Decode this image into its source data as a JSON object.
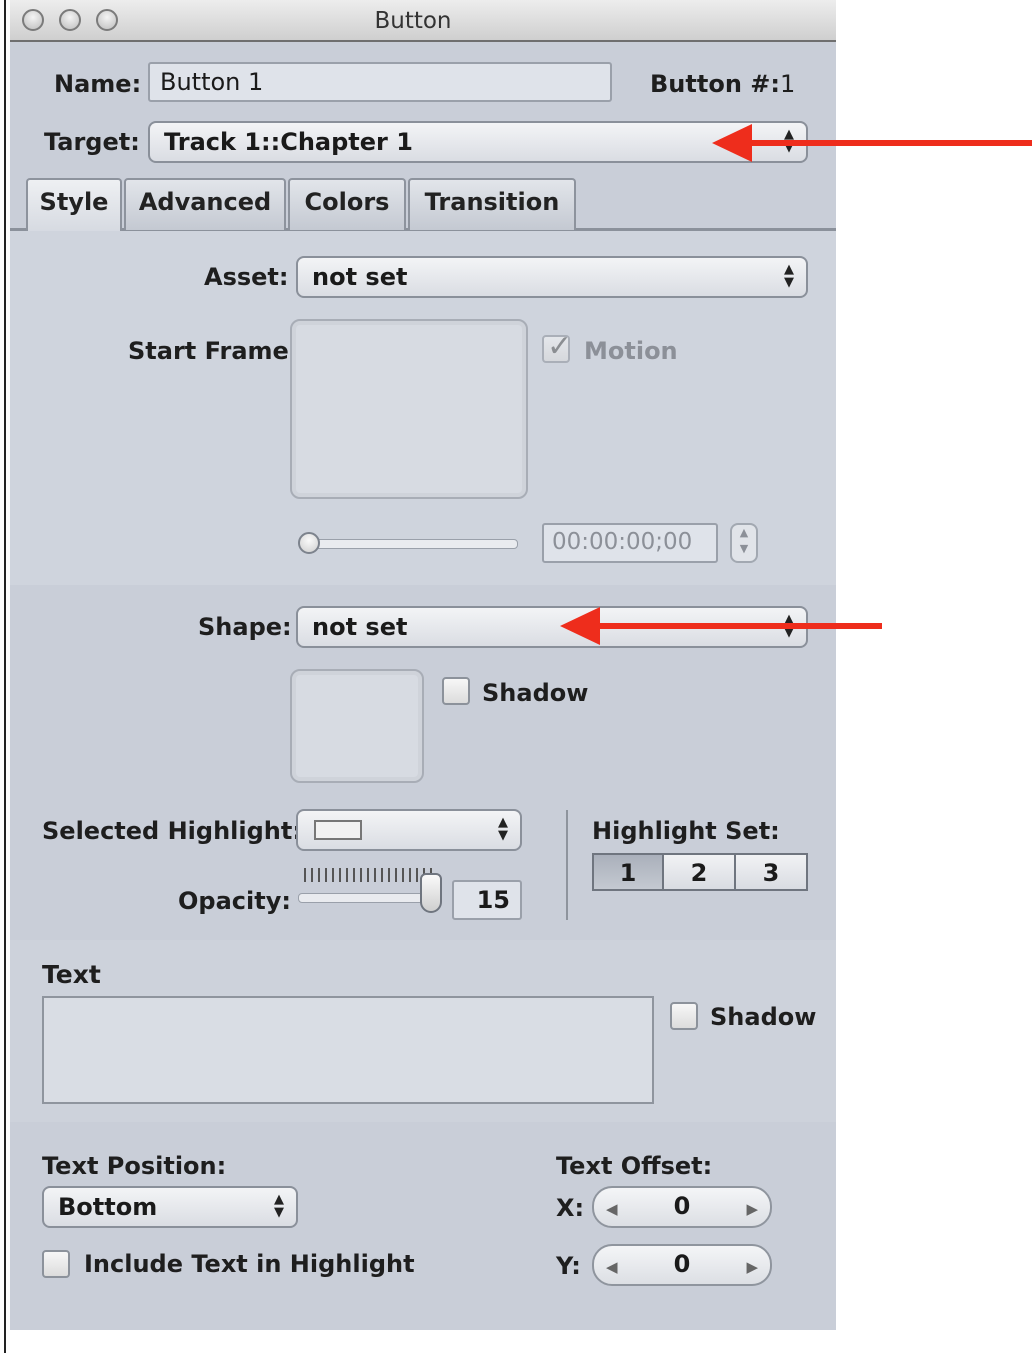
{
  "window": {
    "title": "Button"
  },
  "name_row": {
    "label": "Name:",
    "value": "Button 1",
    "button_num_label": "Button #:",
    "button_num_value": "1"
  },
  "target": {
    "label": "Target:",
    "value": "Track 1::Chapter 1"
  },
  "tabs": [
    {
      "label": "Style",
      "active": true
    },
    {
      "label": "Advanced",
      "active": false
    },
    {
      "label": "Colors",
      "active": false
    },
    {
      "label": "Transition",
      "active": false
    }
  ],
  "asset": {
    "label": "Asset:",
    "value": "not set"
  },
  "start_frame": {
    "label": "Start Frame:",
    "motion_label": "Motion",
    "motion_checked": true,
    "timecode": "00:00:00;00"
  },
  "shape": {
    "label": "Shape:",
    "value": "not set",
    "shadow_label": "Shadow"
  },
  "highlight": {
    "selected_label": "Selected Highlight:",
    "opacity_label": "Opacity:",
    "opacity_value": "15",
    "set_label": "Highlight Set:",
    "set_options": [
      "1",
      "2",
      "3"
    ],
    "set_selected": "1"
  },
  "text": {
    "heading": "Text",
    "shadow_label": "Shadow"
  },
  "text_position": {
    "label": "Text Position:",
    "value": "Bottom",
    "include_label": "Include Text in Highlight"
  },
  "text_offset": {
    "label": "Text Offset:",
    "x_label": "X:",
    "x_value": "0",
    "y_label": "Y:",
    "y_value": "0"
  },
  "colors": {
    "annotation_arrow": "#ee2d1c",
    "window_bg": "#c9ced8"
  }
}
